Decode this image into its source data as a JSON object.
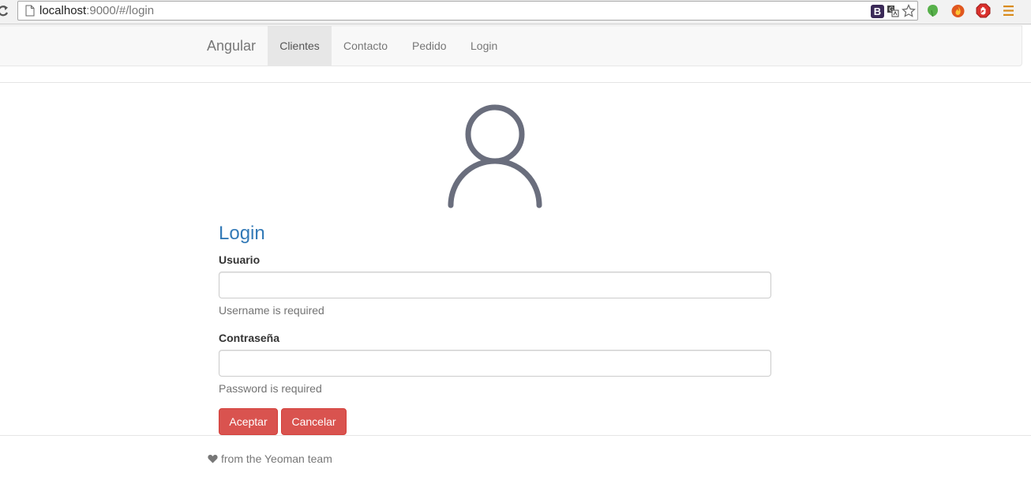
{
  "browser": {
    "url_host": "localhost",
    "url_rest": ":9000/#/login",
    "extension_badge": "B"
  },
  "navbar": {
    "brand": "Angular",
    "items": [
      {
        "label": "Clientes",
        "active": true
      },
      {
        "label": "Contacto",
        "active": false
      },
      {
        "label": "Pedido",
        "active": false
      },
      {
        "label": "Login",
        "active": false
      }
    ]
  },
  "login": {
    "title": "Login",
    "username_label": "Usuario",
    "username_value": "",
    "username_help": "Username is required",
    "password_label": "Contraseña",
    "password_value": "",
    "password_help": "Password is required",
    "accept_label": "Aceptar",
    "cancel_label": "Cancelar"
  },
  "footer": {
    "text": "from the Yeoman team"
  },
  "colors": {
    "link_blue": "#337ab7",
    "danger_red": "#d9534f",
    "avatar_gray": "#6a6e7d"
  },
  "icons": [
    "reload-icon",
    "page-icon",
    "bootstrap-extension-icon",
    "translate-icon",
    "star-icon",
    "evernote-icon",
    "fire-extension-icon",
    "adblock-icon",
    "menu-icon",
    "user-avatar-icon",
    "heart-icon"
  ]
}
